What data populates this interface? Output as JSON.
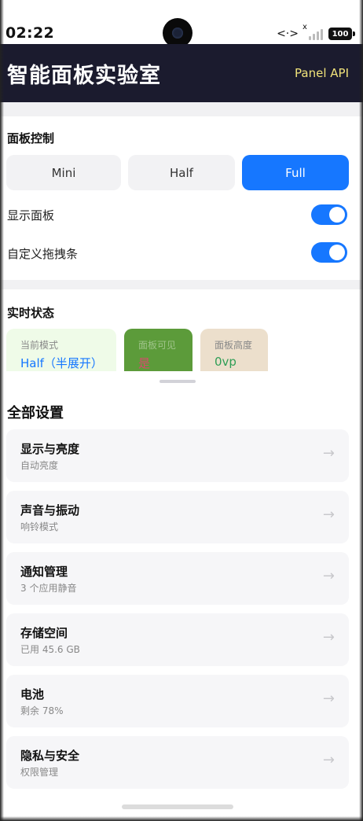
{
  "status_bar": {
    "time": "02:22",
    "network_glyph": "<·>",
    "signal_x": "x",
    "battery": "100"
  },
  "header": {
    "title": "智能面板实验室",
    "api_link": "Panel API"
  },
  "panel_control": {
    "title": "面板控制",
    "modes": [
      "Mini",
      "Half",
      "Full"
    ],
    "selected_mode": "Full",
    "show_panel": {
      "label": "显示面板",
      "on": true
    },
    "custom_drag_bar": {
      "label": "自定义拖拽条",
      "on": true
    }
  },
  "live_status": {
    "title": "实时状态",
    "cards": [
      {
        "key": "当前模式",
        "value": "Half（半展开）",
        "bg": "#effbe8",
        "value_color": "#1677ff"
      },
      {
        "key": "面板可见",
        "value": "是",
        "bg": "#5c9b3a",
        "value_color": "#d9486e"
      },
      {
        "key": "面板高度",
        "value": "0vp",
        "bg": "#ecdfcc",
        "value_color": "#2f9e56"
      }
    ]
  },
  "settings": {
    "title": "全部设置",
    "arrow": "→",
    "items": [
      {
        "name": "显示与亮度",
        "sub": "自动亮度"
      },
      {
        "name": "声音与振动",
        "sub": "响铃模式"
      },
      {
        "name": "通知管理",
        "sub": "3 个应用静音"
      },
      {
        "name": "存储空间",
        "sub": "已用 45.6 GB"
      },
      {
        "name": "电池",
        "sub": "剩余 78%"
      },
      {
        "name": "隐私与安全",
        "sub": "权限管理"
      }
    ]
  },
  "colors": {
    "header_bg": "#1b1b2e",
    "accent": "#1677ff",
    "api_link": "#f1e37a"
  }
}
